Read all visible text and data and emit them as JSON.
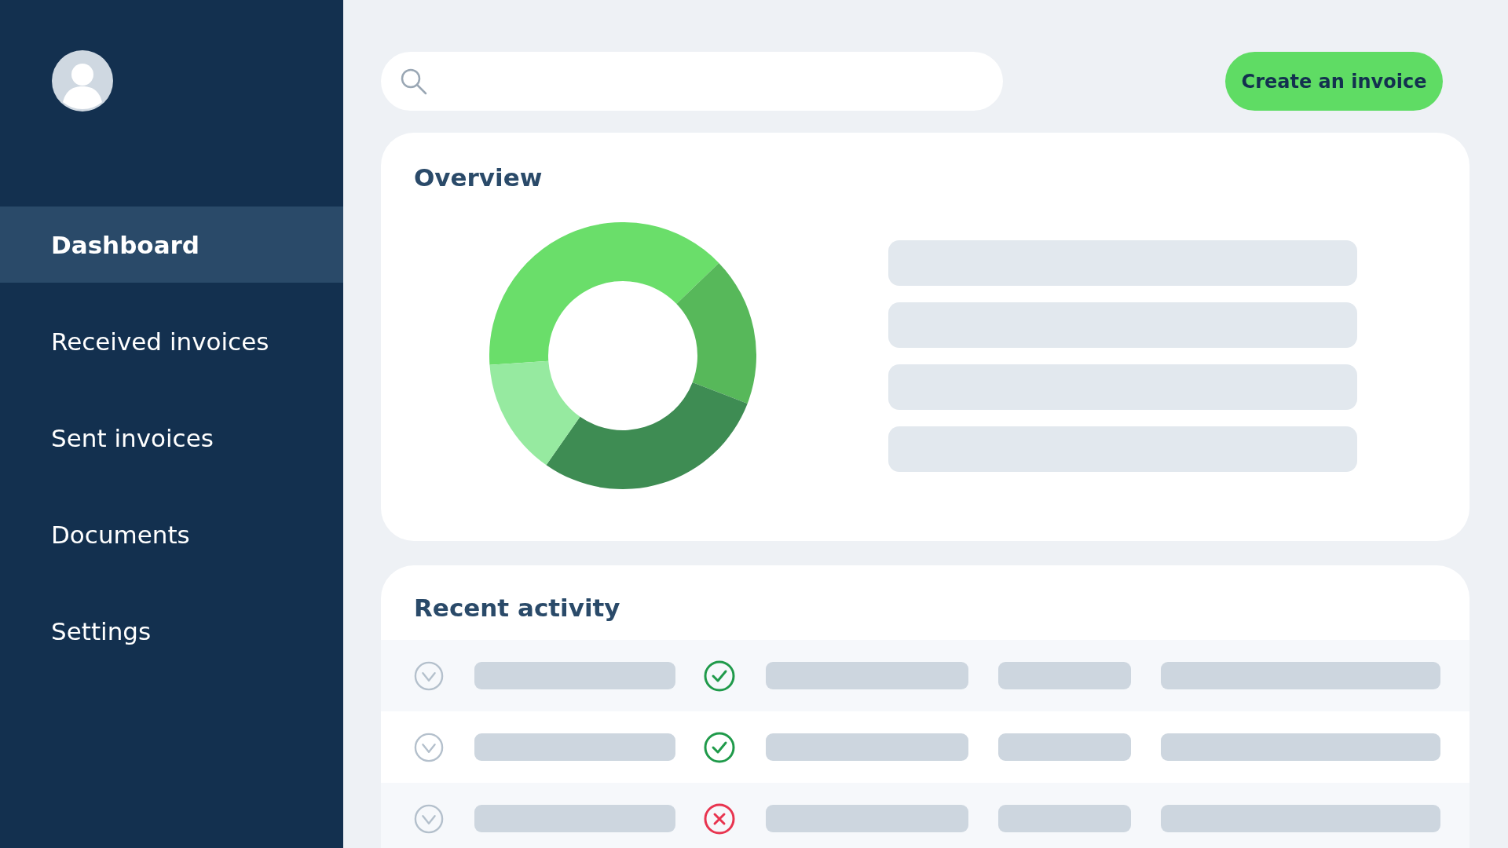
{
  "sidebar": {
    "items": [
      {
        "label": "Dashboard",
        "selected": true
      },
      {
        "label": "Received invoices",
        "selected": false
      },
      {
        "label": "Sent invoices",
        "selected": false
      },
      {
        "label": "Documents",
        "selected": false
      },
      {
        "label": "Settings",
        "selected": false
      }
    ]
  },
  "create_button": "Create an invoice",
  "overview": {
    "title": "Overview"
  },
  "recent_activity": {
    "title": "Recent activity",
    "rows": [
      {
        "kind": "success"
      },
      {
        "kind": "success"
      },
      {
        "kind": "error"
      }
    ]
  }
}
